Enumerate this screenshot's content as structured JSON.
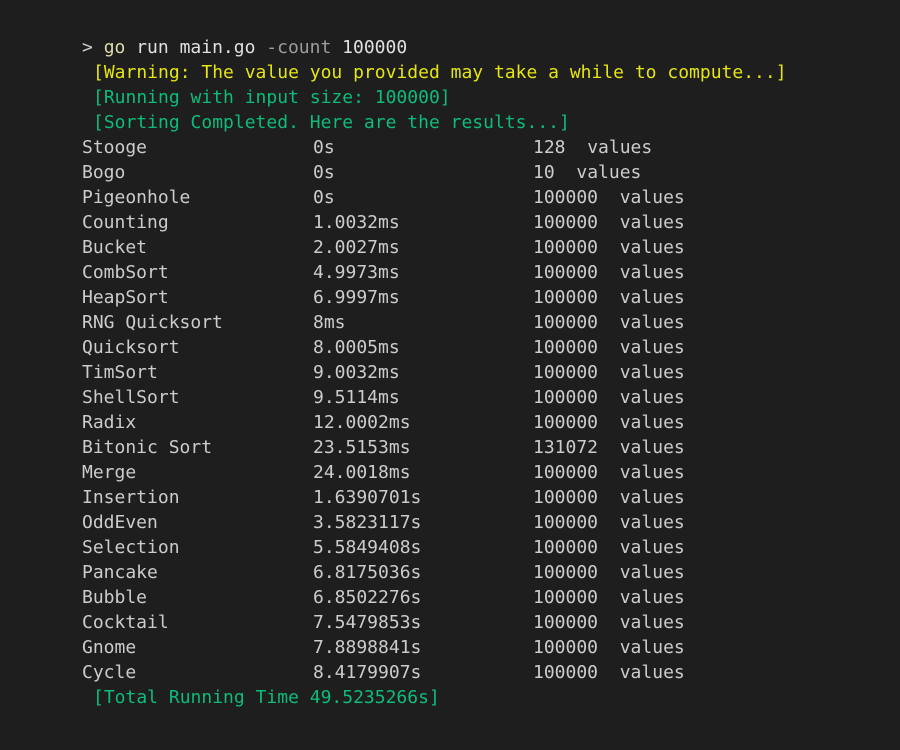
{
  "command": {
    "prompt": ">",
    "program": "go",
    "args": "run main.go",
    "flag": "-count",
    "value": "100000"
  },
  "messages": {
    "warning": "[Warning: The value you provided may take a while to compute...]",
    "running": "[Running with input size: 100000]",
    "completed": "[Sorting Completed. Here are the results...]",
    "total": "[Total Running Time 49.5235266s]"
  },
  "results": [
    {
      "name": "Stooge",
      "time": "0s",
      "count": "128",
      "unit": "values"
    },
    {
      "name": "Bogo",
      "time": "0s",
      "count": "10",
      "unit": "values"
    },
    {
      "name": "Pigeonhole",
      "time": "0s",
      "count": "100000",
      "unit": "values"
    },
    {
      "name": "Counting",
      "time": "1.0032ms",
      "count": "100000",
      "unit": "values"
    },
    {
      "name": "Bucket",
      "time": "2.0027ms",
      "count": "100000",
      "unit": "values"
    },
    {
      "name": "CombSort",
      "time": "4.9973ms",
      "count": "100000",
      "unit": "values"
    },
    {
      "name": "HeapSort",
      "time": "6.9997ms",
      "count": "100000",
      "unit": "values"
    },
    {
      "name": "RNG Quicksort",
      "time": "8ms",
      "count": "100000",
      "unit": "values"
    },
    {
      "name": "Quicksort",
      "time": "8.0005ms",
      "count": "100000",
      "unit": "values"
    },
    {
      "name": "TimSort",
      "time": "9.0032ms",
      "count": "100000",
      "unit": "values"
    },
    {
      "name": "ShellSort",
      "time": "9.5114ms",
      "count": "100000",
      "unit": "values"
    },
    {
      "name": "Radix",
      "time": "12.0002ms",
      "count": "100000",
      "unit": "values"
    },
    {
      "name": "Bitonic Sort",
      "time": "23.5153ms",
      "count": "131072",
      "unit": "values"
    },
    {
      "name": "Merge",
      "time": "24.0018ms",
      "count": "100000",
      "unit": "values"
    },
    {
      "name": "Insertion",
      "time": "1.6390701s",
      "count": "100000",
      "unit": "values"
    },
    {
      "name": "OddEven",
      "time": "3.5823117s",
      "count": "100000",
      "unit": "values"
    },
    {
      "name": "Selection",
      "time": "5.5849408s",
      "count": "100000",
      "unit": "values"
    },
    {
      "name": "Pancake",
      "time": "6.8175036s",
      "count": "100000",
      "unit": "values"
    },
    {
      "name": "Bubble",
      "time": "6.8502276s",
      "count": "100000",
      "unit": "values"
    },
    {
      "name": "Cocktail",
      "time": "7.5479853s",
      "count": "100000",
      "unit": "values"
    },
    {
      "name": "Gnome",
      "time": "7.8898841s",
      "count": "100000",
      "unit": "values"
    },
    {
      "name": "Cycle",
      "time": "8.4179907s",
      "count": "100000",
      "unit": "values"
    }
  ],
  "colors": {
    "background": "#1e1e1e",
    "warning": "#e5e510",
    "success": "#23d18b"
  }
}
